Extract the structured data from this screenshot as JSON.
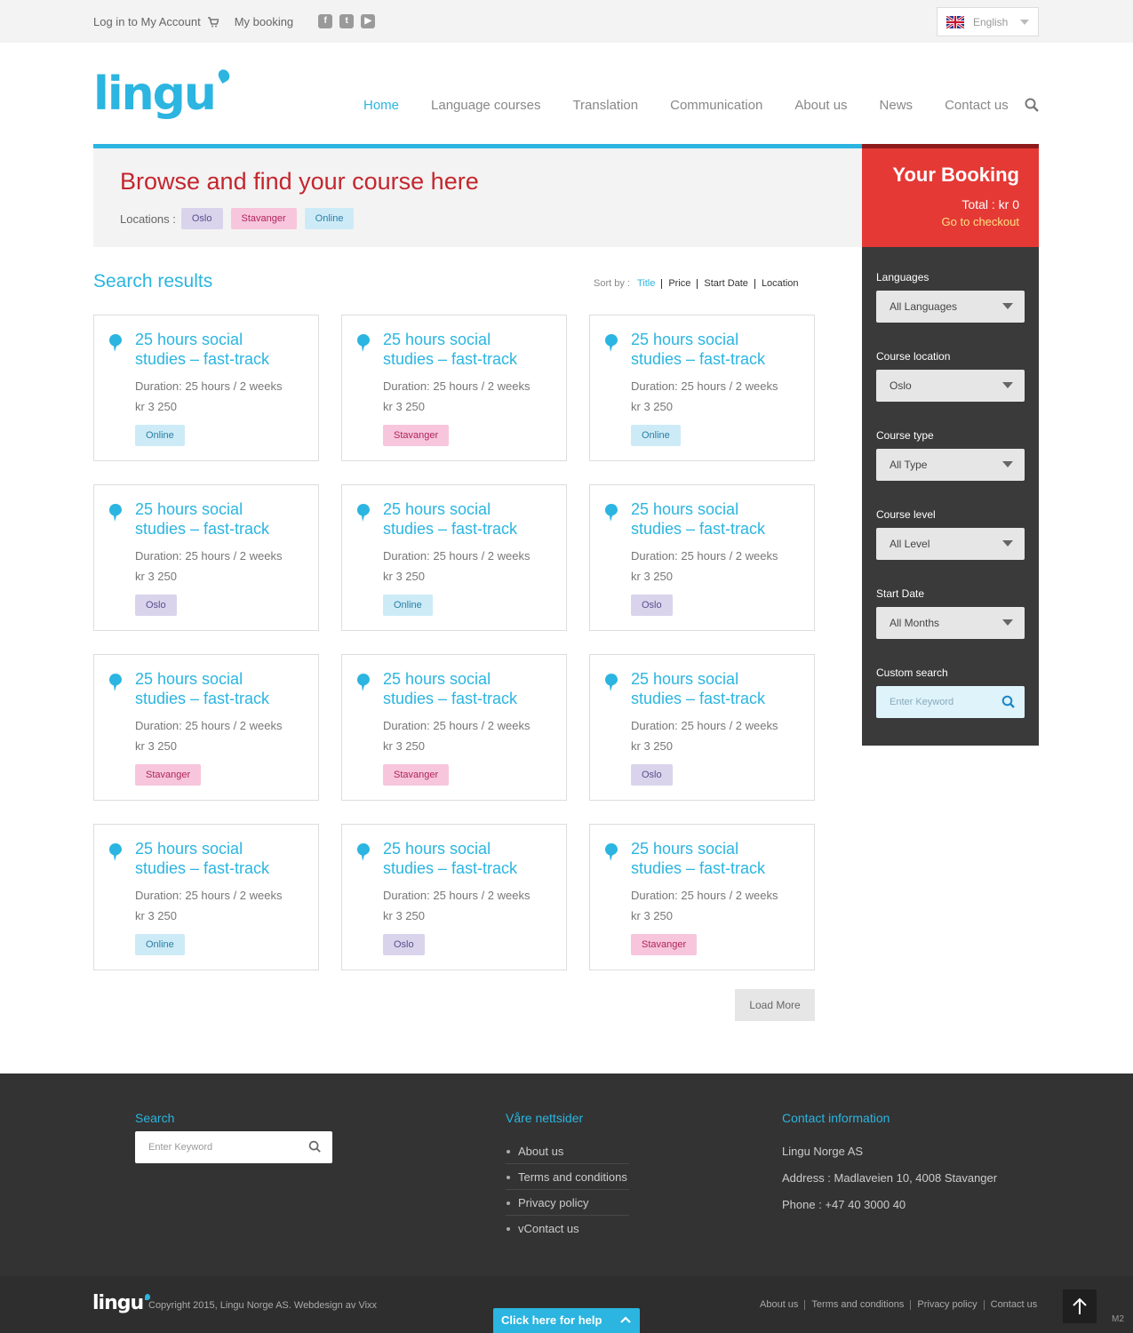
{
  "topbar": {
    "login": "Log in to My Account",
    "booking": "My booking",
    "language": "English"
  },
  "nav": {
    "items": [
      "Home",
      "Language courses",
      "Translation",
      "Communication",
      "About us",
      "News",
      "Contact us"
    ]
  },
  "logo": {
    "text": "lingu"
  },
  "browse": {
    "title": "Browse and find your course here",
    "locations_label": "Locations :",
    "locations": [
      "Oslo",
      "Stavanger",
      "Online"
    ]
  },
  "booking": {
    "title": "Your Booking",
    "total": "Total : kr 0",
    "checkout": "Go to checkout"
  },
  "filters": {
    "languages_label": "Languages",
    "languages_value": "All Languages",
    "location_label": "Course location",
    "location_value": "Oslo",
    "type_label": "Course type",
    "type_value": "All Type",
    "level_label": "Course level",
    "level_value": "All Level",
    "start_label": "Start Date",
    "start_value": "All Months",
    "custom_label": "Custom search",
    "custom_placeholder": "Enter Keyword"
  },
  "results": {
    "title": "Search results",
    "sort_label": "Sort by :",
    "sort_options": [
      "Title",
      "Price",
      "Start Date",
      "Location"
    ],
    "load_more": "Load More",
    "cards": [
      {
        "line1": "25 hours social",
        "line2": "studies – fast-track",
        "duration": "Duration: 25 hours / 2 weeks",
        "price": "kr 3 250",
        "tag": "Online"
      },
      {
        "line1": "25 hours social",
        "line2": "studies – fast-track",
        "duration": "Duration: 25 hours / 2 weeks",
        "price": "kr 3 250",
        "tag": "Stavanger"
      },
      {
        "line1": "25 hours social",
        "line2": "studies – fast-track",
        "duration": "Duration: 25 hours / 2 weeks",
        "price": "kr 3 250",
        "tag": "Online"
      },
      {
        "line1": "25 hours social",
        "line2": "studies – fast-track",
        "duration": "Duration: 25 hours / 2 weeks",
        "price": "kr 3 250",
        "tag": "Oslo"
      },
      {
        "line1": "25 hours social",
        "line2": "studies – fast-track",
        "duration": "Duration: 25 hours / 2 weeks",
        "price": "kr 3 250",
        "tag": "Online"
      },
      {
        "line1": "25 hours social",
        "line2": "studies – fast-track",
        "duration": "Duration: 25 hours / 2 weeks",
        "price": "kr 3 250",
        "tag": "Oslo"
      },
      {
        "line1": "25 hours social",
        "line2": "studies – fast-track",
        "duration": "Duration: 25 hours / 2 weeks",
        "price": "kr 3 250",
        "tag": "Stavanger"
      },
      {
        "line1": "25 hours social",
        "line2": "studies – fast-track",
        "duration": "Duration: 25 hours / 2 weeks",
        "price": "kr 3 250",
        "tag": "Stavanger"
      },
      {
        "line1": "25 hours social",
        "line2": "studies – fast-track",
        "duration": "Duration: 25 hours / 2 weeks",
        "price": "kr 3 250",
        "tag": "Oslo"
      },
      {
        "line1": "25 hours social",
        "line2": "studies – fast-track",
        "duration": "Duration: 25 hours / 2 weeks",
        "price": "kr 3 250",
        "tag": "Online"
      },
      {
        "line1": "25 hours social",
        "line2": "studies – fast-track",
        "duration": "Duration: 25 hours / 2 weeks",
        "price": "kr 3 250",
        "tag": "Oslo"
      },
      {
        "line1": "25 hours social",
        "line2": "studies – fast-track",
        "duration": "Duration: 25 hours / 2 weeks",
        "price": "kr 3 250",
        "tag": "Stavanger"
      }
    ]
  },
  "footer": {
    "search_title": "Search",
    "search_placeholder": "Enter Keyword",
    "sites_title": "Våre nettsider",
    "sites": [
      "About us",
      "Terms and conditions",
      "Privacy policy",
      "vContact us"
    ],
    "contact_title": "Contact information",
    "company": "Lingu Norge AS",
    "address": "Address : Madlaveien 10, 4008 Stavanger",
    "phone": "Phone :  +47 40 3000 40",
    "copyright": "Copyright 2015, Lingu Norge AS. Webdesign av Vixx",
    "bottom_links": [
      "About us",
      "Terms and conditions",
      "Privacy policy",
      "Contact us"
    ],
    "help": "Click here for help",
    "version": "M2"
  },
  "colors": {
    "accent": "#2bb5e0",
    "booking_red": "#e53935",
    "title_red": "#c4262e",
    "sidebar_dark": "#3a3a3a",
    "footer_dark": "#333333"
  },
  "icons": {
    "cart": "cart-icon",
    "facebook": "facebook-icon",
    "twitter": "twitter-icon",
    "youtube": "youtube-icon",
    "search": "search-icon",
    "flag": "uk-flag-icon",
    "bubble": "speech-bubble-icon",
    "arrow_up": "arrow-up-icon"
  }
}
